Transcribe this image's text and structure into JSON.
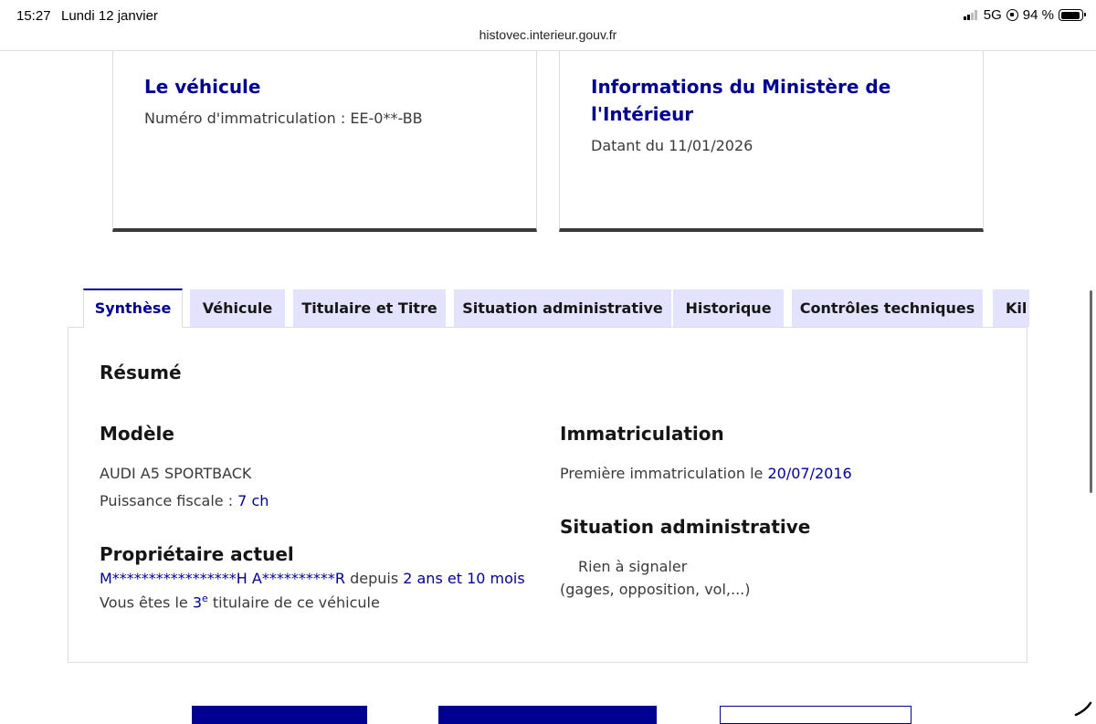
{
  "status_bar": {
    "time": "15:27",
    "date": "Lundi 12 janvier",
    "network": "5G",
    "battery": "94 %",
    "battery_level": 0.94
  },
  "browser": {
    "url": "histovec.interieur.gouv.fr"
  },
  "cards": {
    "vehicle": {
      "title": "Le véhicule",
      "plate": "Numéro d'immatriculation : EE-0**-BB"
    },
    "ministry": {
      "title": "Informations du Ministère de l'Intérieur",
      "date": "Datant du 11/01/2026"
    }
  },
  "tabs": [
    {
      "label": "Synthèse",
      "active": true
    },
    {
      "label": "Véhicule",
      "active": false
    },
    {
      "label": "Titulaire et Titre",
      "active": false
    },
    {
      "label": "Situation administrative",
      "active": false
    },
    {
      "label": "Historique",
      "active": false
    },
    {
      "label": "Contrôles techniques",
      "active": false
    },
    {
      "label": "Kil",
      "active": false
    }
  ],
  "summary": {
    "heading": "Résumé",
    "model": {
      "heading": "Modèle",
      "name": "AUDI A5 SPORTBACK",
      "power_label": "Puissance fiscale : ",
      "power_value": "7 ch"
    },
    "owner": {
      "heading": "Propriétaire actuel",
      "name": "M*****************H A**********R",
      "since_label": " depuis ",
      "since_value": "2 ans et 10 mois",
      "rank_prefix": "Vous êtes le ",
      "rank_number": "3",
      "rank_suffix": "e",
      "rank_tail": " titulaire de ce véhicule"
    },
    "registration": {
      "heading": "Immatriculation",
      "label": "Première immatriculation le ",
      "date": "20/07/2016"
    },
    "admin": {
      "heading": "Situation administrative",
      "status": "Rien à signaler",
      "detail": "(gages, opposition, vol,...)"
    }
  },
  "colors": {
    "primary_blue": "#000091",
    "tab_background": "#e3e3fd",
    "card_border_bottom": "#3a3a3a"
  }
}
